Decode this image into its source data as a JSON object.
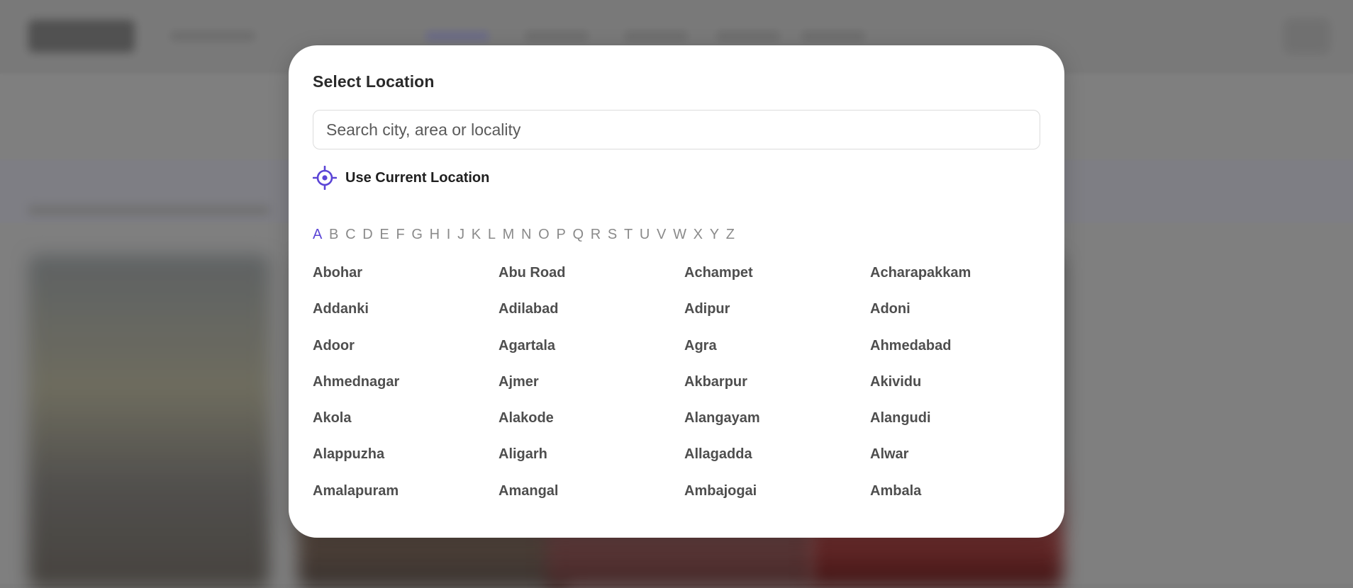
{
  "modal": {
    "title": "Select Location",
    "search_placeholder": "Search city, area or locality",
    "search_value": "",
    "current_location_label": "Use Current Location"
  },
  "alphabet": {
    "letters": [
      "A",
      "B",
      "C",
      "D",
      "E",
      "F",
      "G",
      "H",
      "I",
      "J",
      "K",
      "L",
      "M",
      "N",
      "O",
      "P",
      "Q",
      "R",
      "S",
      "T",
      "U",
      "V",
      "W",
      "X",
      "Y",
      "Z"
    ],
    "selected": "A"
  },
  "cities": [
    "Abohar",
    "Abu Road",
    "Achampet",
    "Acharapakkam",
    "Addanki",
    "Adilabad",
    "Adipur",
    "Adoni",
    "Adoor",
    "Agartala",
    "Agra",
    "Ahmedabad",
    "Ahmednagar",
    "Ajmer",
    "Akbarpur",
    "Akividu",
    "Akola",
    "Alakode",
    "Alangayam",
    "Alangudi",
    "Alappuzha",
    "Aligarh",
    "Allagadda",
    "Alwar",
    "Amalapuram",
    "Amangal",
    "Ambajogai",
    "Ambala"
  ],
  "colors": {
    "accent": "#5b45d6",
    "overlay": "#808080",
    "modal_bg": "#ffffff"
  },
  "icons": {
    "current_location": "crosshair-location-icon"
  }
}
